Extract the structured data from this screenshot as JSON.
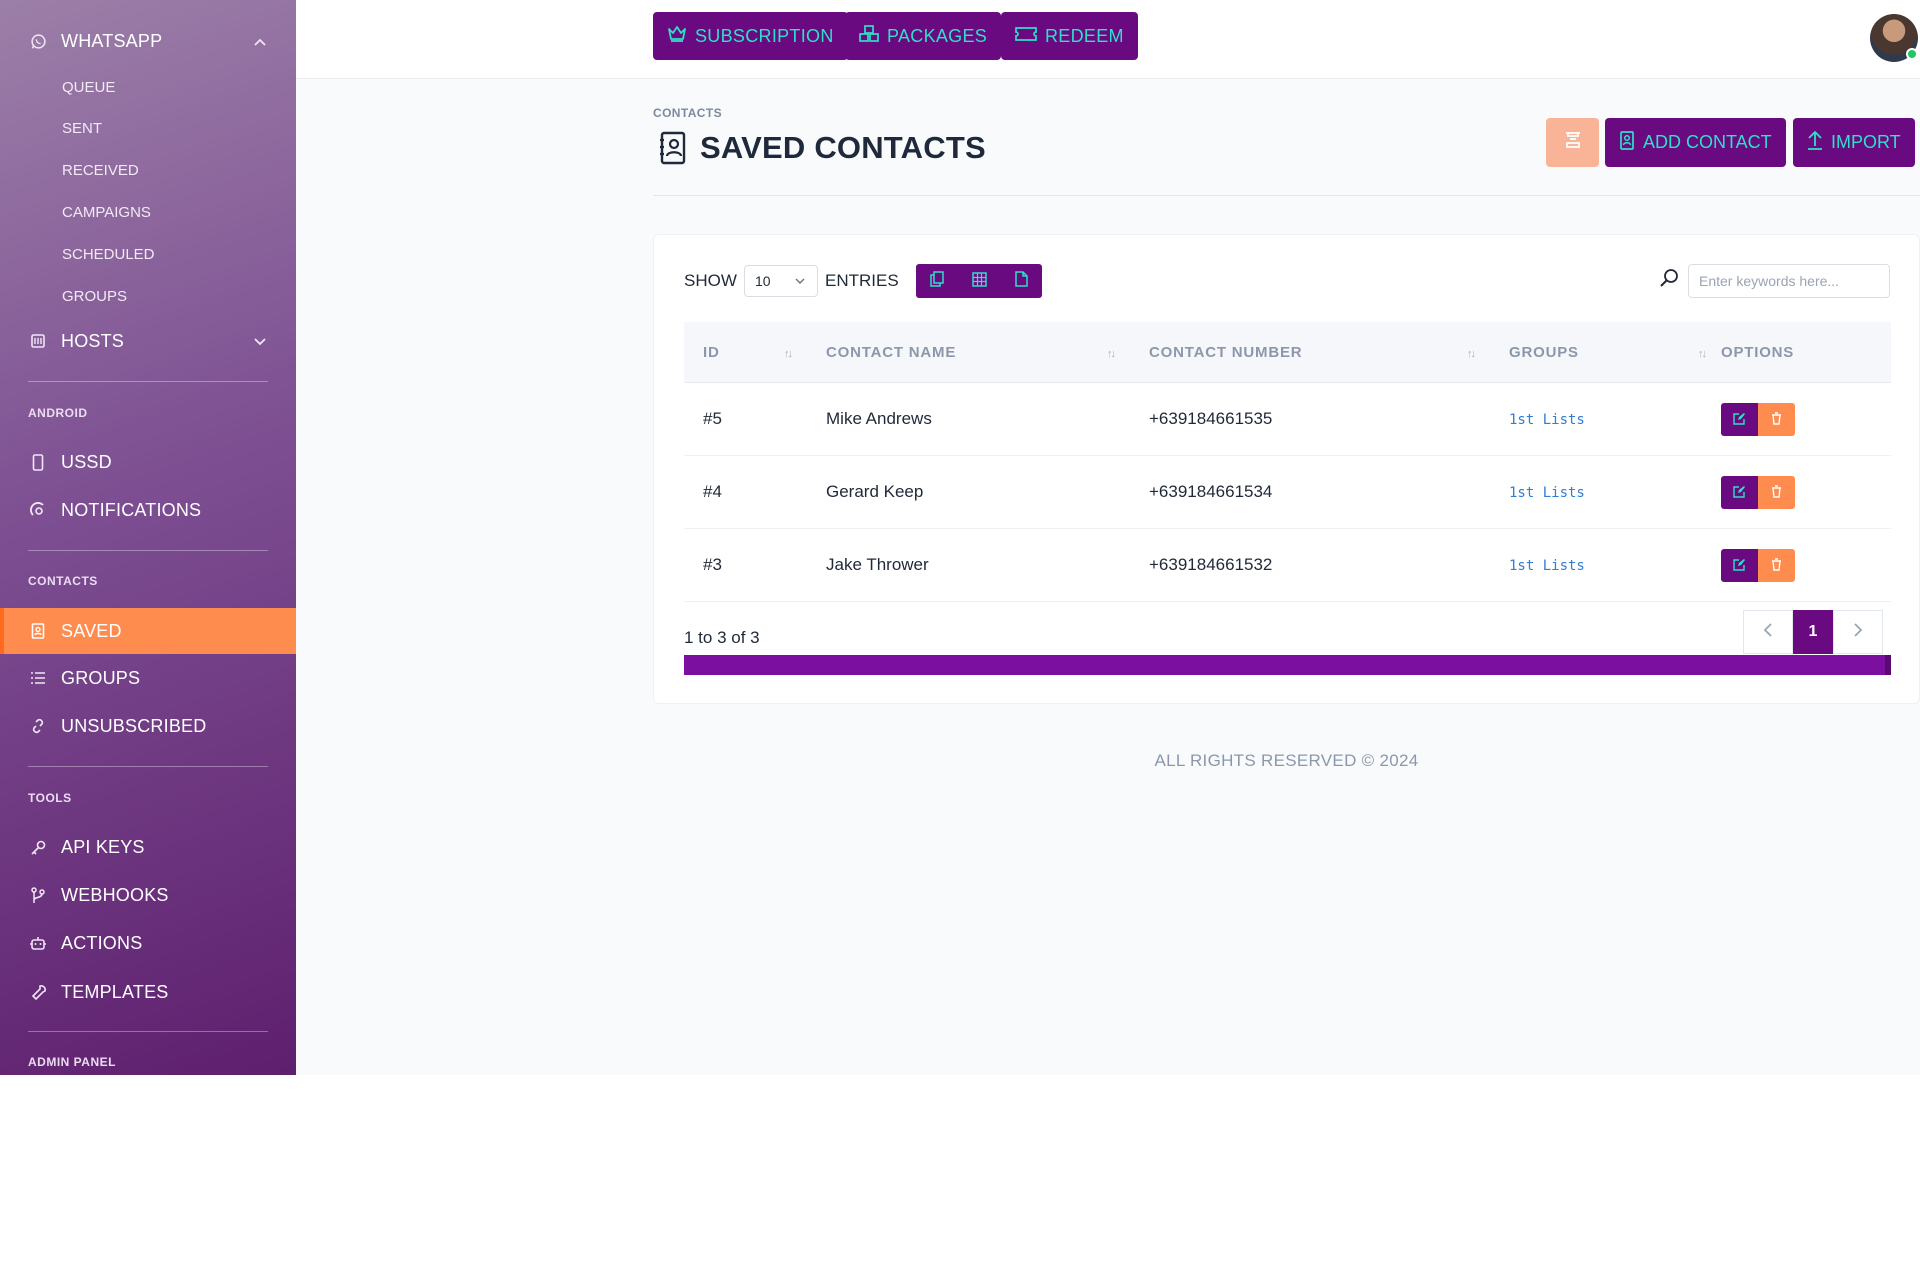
{
  "sidebar": {
    "whatsapp": {
      "label": "WHATSAPP",
      "sub": [
        "QUEUE",
        "SENT",
        "RECEIVED",
        "CAMPAIGNS",
        "SCHEDULED",
        "GROUPS"
      ]
    },
    "hosts": "HOSTS",
    "sections": {
      "android": "ANDROID",
      "contacts": "CONTACTS",
      "tools": "TOOLS",
      "admin": "ADMIN PANEL"
    },
    "android_items": [
      "USSD",
      "NOTIFICATIONS"
    ],
    "contacts_items": [
      "SAVED",
      "GROUPS",
      "UNSUBSCRIBED"
    ],
    "tools_items": [
      "API KEYS",
      "WEBHOOKS",
      "ACTIONS",
      "TEMPLATES"
    ]
  },
  "topbar": {
    "subscription": "SUBSCRIPTION",
    "packages": "PACKAGES",
    "redeem": "REDEEM"
  },
  "header": {
    "breadcrumb": "CONTACTS",
    "title": "SAVED CONTACTS",
    "add_contact": "ADD CONTACT",
    "import": "IMPORT"
  },
  "table_controls": {
    "show": "SHOW",
    "entries_value": "10",
    "entries": "ENTRIES",
    "search_placeholder": "Enter keywords here..."
  },
  "table": {
    "columns": [
      "ID",
      "CONTACT NAME",
      "CONTACT NUMBER",
      "GROUPS",
      "OPTIONS"
    ],
    "rows": [
      {
        "id": "#5",
        "name": "Mike Andrews",
        "number": "+639184661535",
        "group": "1st Lists"
      },
      {
        "id": "#4",
        "name": "Gerard Keep",
        "number": "+639184661534",
        "group": "1st Lists"
      },
      {
        "id": "#3",
        "name": "Jake Thrower",
        "number": "+639184661532",
        "group": "1st Lists"
      }
    ]
  },
  "pagination": {
    "info": "1 to 3 of 3",
    "current": "1"
  },
  "footer": "ALL RIGHTS RESERVED © 2024",
  "colors": {
    "primary": "#6a0a80",
    "accent_text": "#2de0c8",
    "active": "#ff8c4f",
    "danger": "#ff8c4f"
  },
  "icons": {
    "crown": "crown-icon",
    "packages": "boxes-icon",
    "redeem": "ticket-icon",
    "search": "search-icon"
  }
}
